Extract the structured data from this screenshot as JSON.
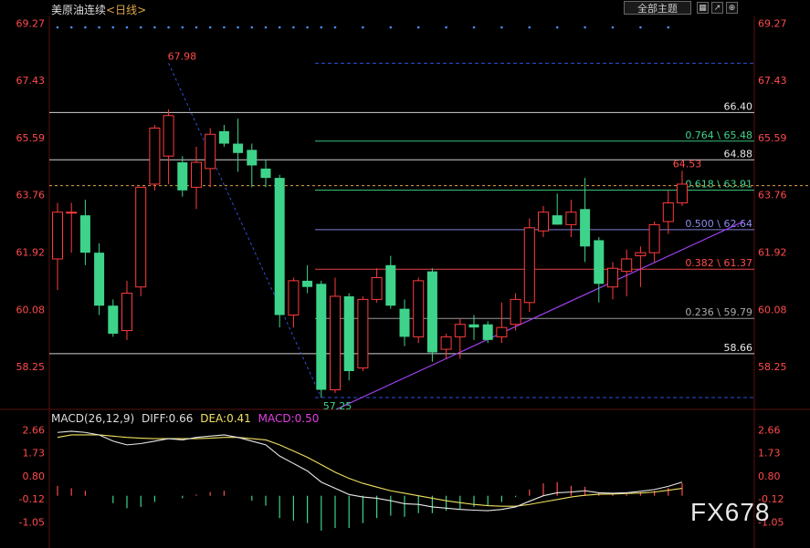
{
  "header": {
    "title": "美原油连续",
    "period": "<日线>",
    "main_button": "全部主题",
    "icons": [
      "grid-icon",
      "chart-icon",
      "zoom-icon"
    ]
  },
  "watermark": "FX678",
  "chart_data": [
    {
      "type": "candlestick",
      "title": "美原油连续",
      "period": "日线",
      "ylim": [
        56.9,
        69.6
      ],
      "y_ticks": [
        "69.27",
        "67.43",
        "65.59",
        "63.76",
        "61.92",
        "60.08",
        "58.25"
      ],
      "colors": {
        "up": "#ff3b3b",
        "down": "#3ed38a"
      },
      "candles": [
        {
          "o": 61.7,
          "h": 63.5,
          "l": 60.7,
          "c": 63.2
        },
        {
          "o": 63.2,
          "h": 63.5,
          "l": 61.9,
          "c": 63.2
        },
        {
          "o": 63.1,
          "h": 63.6,
          "l": 61.5,
          "c": 61.9
        },
        {
          "o": 61.9,
          "h": 62.2,
          "l": 59.9,
          "c": 60.2
        },
        {
          "o": 60.2,
          "h": 60.4,
          "l": 59.2,
          "c": 59.3
        },
        {
          "o": 59.4,
          "h": 61.0,
          "l": 59.1,
          "c": 60.6
        },
        {
          "o": 60.8,
          "h": 64.0,
          "l": 60.5,
          "c": 64.0
        },
        {
          "o": 64.1,
          "h": 66.0,
          "l": 63.9,
          "c": 65.9
        },
        {
          "o": 65.0,
          "h": 66.5,
          "l": 64.1,
          "c": 66.3
        },
        {
          "o": 64.8,
          "h": 65.0,
          "l": 63.7,
          "c": 63.9
        },
        {
          "o": 64.0,
          "h": 65.3,
          "l": 63.3,
          "c": 64.8
        },
        {
          "o": 64.6,
          "h": 65.9,
          "l": 64.0,
          "c": 65.7
        },
        {
          "o": 65.8,
          "h": 66.0,
          "l": 65.3,
          "c": 65.4
        },
        {
          "o": 65.4,
          "h": 66.2,
          "l": 64.5,
          "c": 65.1
        },
        {
          "o": 65.2,
          "h": 65.4,
          "l": 64.0,
          "c": 64.7
        },
        {
          "o": 64.6,
          "h": 64.9,
          "l": 64.0,
          "c": 64.3
        },
        {
          "o": 64.3,
          "h": 64.4,
          "l": 59.5,
          "c": 59.9
        },
        {
          "o": 59.9,
          "h": 61.1,
          "l": 59.5,
          "c": 61.0
        },
        {
          "o": 61.0,
          "h": 61.5,
          "l": 60.6,
          "c": 60.8
        },
        {
          "o": 60.9,
          "h": 61.0,
          "l": 57.25,
          "c": 57.5
        },
        {
          "o": 57.5,
          "h": 61.1,
          "l": 57.4,
          "c": 60.5
        },
        {
          "o": 60.5,
          "h": 60.6,
          "l": 57.8,
          "c": 58.1
        },
        {
          "o": 58.2,
          "h": 60.5,
          "l": 58.1,
          "c": 60.4
        },
        {
          "o": 60.4,
          "h": 61.4,
          "l": 60.3,
          "c": 61.1
        },
        {
          "o": 61.5,
          "h": 61.8,
          "l": 60.1,
          "c": 60.2
        },
        {
          "o": 60.1,
          "h": 60.4,
          "l": 58.9,
          "c": 59.2
        },
        {
          "o": 59.2,
          "h": 61.1,
          "l": 59.0,
          "c": 61.0
        },
        {
          "o": 61.3,
          "h": 61.4,
          "l": 58.4,
          "c": 58.7
        },
        {
          "o": 58.8,
          "h": 59.3,
          "l": 58.5,
          "c": 59.2
        },
        {
          "o": 59.2,
          "h": 59.8,
          "l": 58.5,
          "c": 59.6
        },
        {
          "o": 59.6,
          "h": 59.9,
          "l": 59.1,
          "c": 59.5
        },
        {
          "o": 59.6,
          "h": 59.7,
          "l": 59.0,
          "c": 59.1
        },
        {
          "o": 59.2,
          "h": 60.3,
          "l": 59.0,
          "c": 59.5
        },
        {
          "o": 59.6,
          "h": 60.6,
          "l": 59.4,
          "c": 60.4
        },
        {
          "o": 60.3,
          "h": 63.0,
          "l": 60.0,
          "c": 62.7
        },
        {
          "o": 62.6,
          "h": 63.4,
          "l": 62.4,
          "c": 63.2
        },
        {
          "o": 63.1,
          "h": 63.8,
          "l": 62.8,
          "c": 62.8
        },
        {
          "o": 62.8,
          "h": 63.6,
          "l": 62.4,
          "c": 63.2
        },
        {
          "o": 63.3,
          "h": 64.3,
          "l": 61.6,
          "c": 62.1
        },
        {
          "o": 62.3,
          "h": 62.4,
          "l": 60.3,
          "c": 60.9
        },
        {
          "o": 60.8,
          "h": 61.6,
          "l": 60.4,
          "c": 61.4
        },
        {
          "o": 61.3,
          "h": 62.0,
          "l": 60.5,
          "c": 61.7
        },
        {
          "o": 61.8,
          "h": 62.1,
          "l": 60.8,
          "c": 61.9
        },
        {
          "o": 61.9,
          "h": 62.9,
          "l": 61.6,
          "c": 62.8
        },
        {
          "o": 62.9,
          "h": 63.9,
          "l": 62.5,
          "c": 63.5
        },
        {
          "o": 63.5,
          "h": 64.53,
          "l": 63.4,
          "c": 64.1
        }
      ],
      "swing_high": {
        "index": 8,
        "value": "67.98"
      },
      "swing_low": {
        "index": 19,
        "value": "57.25"
      },
      "recent_high": {
        "index": 44,
        "value": "64.53"
      },
      "current_price": 64.05,
      "levels": [
        {
          "y": 66.4,
          "label": "66.40",
          "color": "#e8e8e8",
          "from": "left"
        },
        {
          "y": 64.88,
          "label": "64.88",
          "color": "#e8e8e8",
          "from": "left"
        },
        {
          "y": 58.66,
          "label": "58.66",
          "color": "#e8e8e8",
          "from": "left"
        },
        {
          "y": 65.48,
          "label": "0.764 \\ 65.48",
          "color": "#3ed38a",
          "from": "fib"
        },
        {
          "y": 63.91,
          "label": "0.618 \\ 63.91",
          "color": "#3ed38a",
          "from": "fib"
        },
        {
          "y": 62.64,
          "label": "0.500 \\ 62.64",
          "color": "#8c8cf0",
          "from": "fib"
        },
        {
          "y": 61.37,
          "label": "0.382 \\ 61.37",
          "color": "#ff4b4b",
          "from": "fib"
        },
        {
          "y": 59.79,
          "label": "0.236 \\ 59.79",
          "color": "#aaaaaa",
          "from": "fib"
        }
      ],
      "fib_bounds": [
        57.25,
        67.98
      ]
    },
    {
      "type": "macd",
      "params": "MACD(26,12,9)",
      "diff_label": "DIFF:0.66",
      "dea_label": "DEA:0.41",
      "macd_label": "MACD:0.50",
      "ylim": [
        -1.7,
        3.0
      ],
      "y_ticks": [
        "2.66",
        "1.73",
        "0.80",
        "-0.12",
        "-1.05"
      ],
      "diff": [
        2.55,
        2.6,
        2.55,
        2.45,
        2.2,
        2.05,
        2.1,
        2.2,
        2.3,
        2.25,
        2.35,
        2.4,
        2.45,
        2.35,
        2.2,
        2.05,
        1.6,
        1.3,
        1.0,
        0.55,
        0.3,
        0.05,
        -0.05,
        -0.1,
        -0.2,
        -0.32,
        -0.35,
        -0.45,
        -0.5,
        -0.55,
        -0.58,
        -0.6,
        -0.55,
        -0.45,
        -0.22,
        0.0,
        0.12,
        0.15,
        0.2,
        0.12,
        0.1,
        0.12,
        0.18,
        0.25,
        0.38,
        0.55
      ],
      "dea": [
        2.35,
        2.45,
        2.45,
        2.45,
        2.4,
        2.35,
        2.32,
        2.3,
        2.3,
        2.3,
        2.3,
        2.32,
        2.35,
        2.35,
        2.3,
        2.25,
        2.05,
        1.8,
        1.55,
        1.25,
        0.95,
        0.7,
        0.5,
        0.35,
        0.2,
        0.1,
        0.0,
        -0.1,
        -0.2,
        -0.28,
        -0.35,
        -0.4,
        -0.42,
        -0.42,
        -0.35,
        -0.25,
        -0.15,
        -0.05,
        0.02,
        0.06,
        0.07,
        0.09,
        0.11,
        0.15,
        0.22,
        0.3
      ],
      "hist": [
        0.4,
        0.3,
        0.2,
        0.0,
        -0.3,
        -0.5,
        -0.45,
        -0.25,
        0.0,
        -0.1,
        0.05,
        0.15,
        0.2,
        0.0,
        -0.2,
        -0.4,
        -0.9,
        -1.0,
        -1.1,
        -1.4,
        -1.3,
        -1.3,
        -1.1,
        -0.9,
        -0.8,
        -0.85,
        -0.7,
        -0.7,
        -0.6,
        -0.55,
        -0.45,
        -0.4,
        -0.25,
        -0.05,
        0.25,
        0.5,
        0.55,
        0.4,
        0.36,
        0.12,
        0.06,
        0.06,
        0.14,
        0.2,
        0.32,
        0.5
      ]
    }
  ]
}
